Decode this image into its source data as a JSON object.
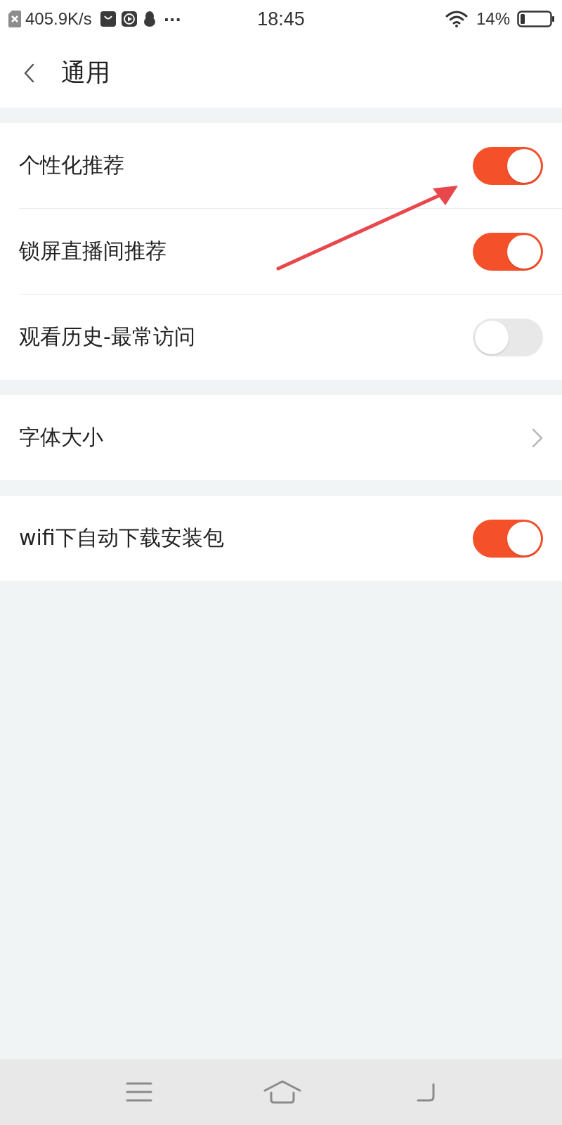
{
  "status_bar": {
    "network_speed": "405.9K/s",
    "more": "···",
    "time": "18:45",
    "battery_percent": "14%"
  },
  "header": {
    "title": "通用"
  },
  "sections": [
    {
      "items": [
        {
          "kind": "toggle",
          "label": "个性化推荐",
          "on": true
        },
        {
          "kind": "toggle",
          "label": "锁屏直播间推荐",
          "on": true
        },
        {
          "kind": "toggle",
          "label": "观看历史-最常访问",
          "on": false
        }
      ]
    },
    {
      "items": [
        {
          "kind": "link",
          "label": "字体大小"
        }
      ]
    },
    {
      "items": [
        {
          "kind": "toggle",
          "label": "wifi下自动下载安装包",
          "on": true
        }
      ]
    }
  ]
}
